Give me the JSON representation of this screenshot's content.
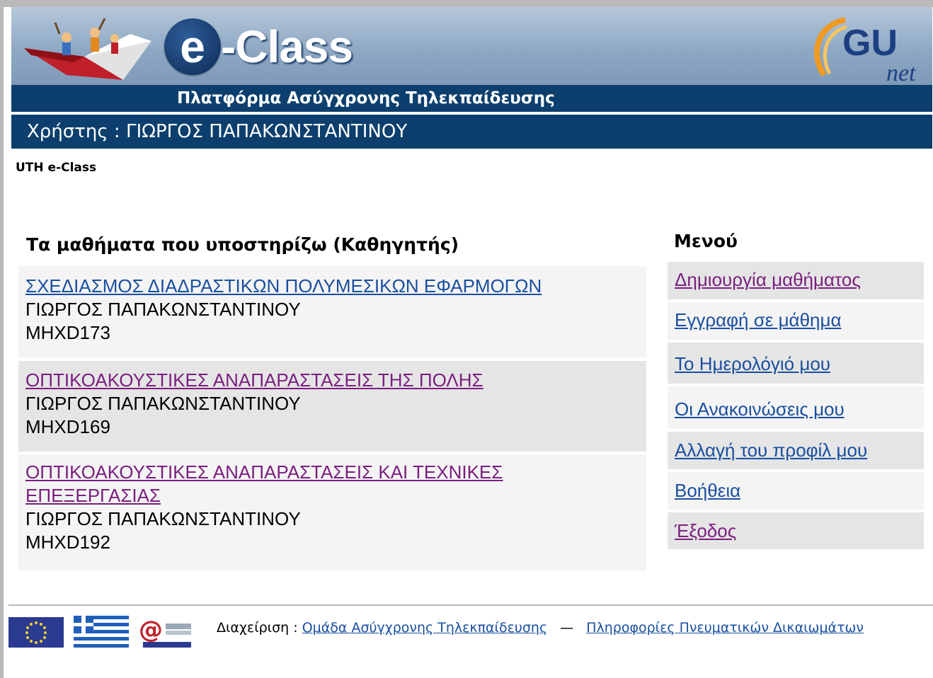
{
  "header": {
    "logo_e": "e",
    "logo_class": "-Class",
    "platform_subtitle": "Πλατφόρμα Ασύγχρονης Τηλεκπαίδευσης",
    "partner_logo_text_top": "GU",
    "partner_logo_text_bottom": "net",
    "user_label": "Χρήστης : ΓΙΩΡΓΟΣ ΠΑΠΑΚΩΝΣΤΑΝΤΙΝΟΥ"
  },
  "breadcrumb": "UTH e-Class",
  "courses": {
    "title": "Τα μαθήματα που υποστηρίζω (Καθηγητής)",
    "items": [
      {
        "title": "ΣΧΕΔΙΑΣΜΟΣ ΔΙΑΔΡΑΣΤΙΚΩΝ ΠΟΛΥΜΕΣΙΚΩΝ ΕΦΑΡΜΟΓΩΝ",
        "teacher": "ΓΙΩΡΓΟΣ ΠΑΠΑΚΩΝΣΤΑΝΤΙΝΟΥ",
        "code": "MHXD173"
      },
      {
        "title": "ΟΠΤΙΚΟΑΚΟΥΣΤΙΚΕΣ ΑΝΑΠΑΡΑΣΤΑΣΕΙΣ ΤΗΣ ΠΟΛΗΣ",
        "teacher": "ΓΙΩΡΓΟΣ ΠΑΠΑΚΩΝΣΤΑΝΤΙΝΟΥ",
        "code": "MHXD169"
      },
      {
        "title_line1": "ΟΠΤΙΚΟΑΚΟΥΣΤΙΚΕΣ ΑΝΑΠΑΡΑΣΤΑΣΕΙΣ ΚΑΙ ΤΕΧΝΙΚΕΣ",
        "title_line2": "ΕΠΕΞΕΡΓΑΣΙΑΣ",
        "teacher": "ΓΙΩΡΓΟΣ ΠΑΠΑΚΩΝΣΤΑΝΤΙΝΟΥ",
        "code": "MHXD192"
      }
    ]
  },
  "menu": {
    "title": "Μενού",
    "items": [
      "Δημιουργία μαθήματος",
      "Εγγραφή σε μάθημα",
      "Το Ημερολόγιό μου",
      "Οι Ανακοινώσεις μου",
      "Αλλαγή του προφίλ μου",
      "Βοήθεια",
      "Έξοδος"
    ]
  },
  "footer": {
    "admin_label": "Διαχείριση :",
    "admin_link": "Ομάδα Ασύγχρονης Τηλεκπαίδευσης",
    "separator": "—",
    "copyright_link": "Πληροφορίες Πνευματικών Δικαιωμάτων"
  },
  "colors": {
    "header_bar": "#0c3f6d",
    "link": "#1a4fa0",
    "visited_link": "#7b1f80"
  }
}
